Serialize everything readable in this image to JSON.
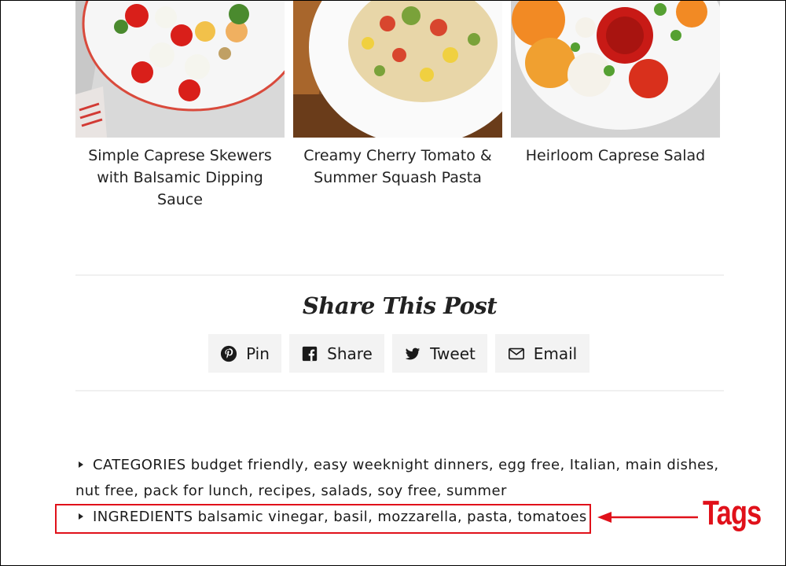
{
  "related": [
    {
      "title": "Simple Caprese Skewers with Balsamic Dipping Sauce"
    },
    {
      "title": "Creamy Cherry Tomato & Summer Squash Pasta"
    },
    {
      "title": "Heirloom Caprese Salad"
    }
  ],
  "share": {
    "heading": "Share This Post",
    "buttons": [
      {
        "label": "Pin",
        "icon": "pinterest-icon"
      },
      {
        "label": "Share",
        "icon": "facebook-icon"
      },
      {
        "label": "Tweet",
        "icon": "twitter-icon"
      },
      {
        "label": "Email",
        "icon": "envelope-icon"
      }
    ]
  },
  "taxonomy": {
    "categories": {
      "label": "CATEGORIES",
      "items": [
        "budget friendly",
        "easy weeknight dinners",
        "egg free",
        "Italian",
        "main dishes",
        "nut free",
        "pack for lunch",
        "recipes",
        "salads",
        "soy free",
        "summer"
      ]
    },
    "ingredients": {
      "label": "INGREDIENTS",
      "items": [
        "balsamic vinegar",
        "basil",
        "mozzarella",
        "pasta",
        "tomatoes"
      ]
    }
  },
  "annotation": {
    "text": "Tags",
    "color": "#e0111a"
  }
}
